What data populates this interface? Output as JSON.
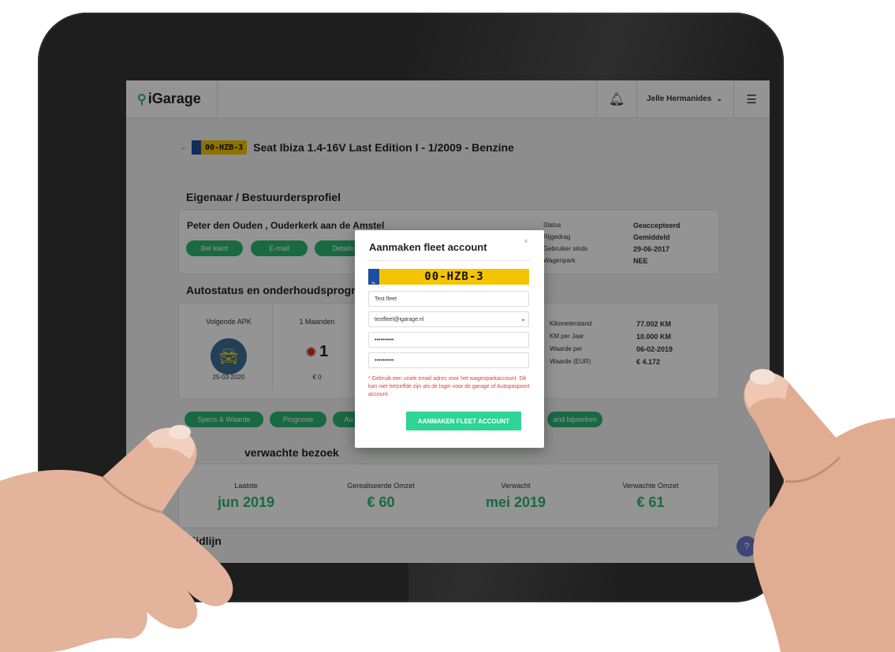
{
  "app": {
    "logo": "iGarage"
  },
  "topbar": {
    "user_name": "Jelle Hermanides"
  },
  "vehicle": {
    "plate": "00-HZB-3",
    "title": "Seat Ibiza 1.4-16V Last Edition I - 1/2009 - Benzine"
  },
  "owner_section": {
    "title": "Eigenaar / Bestuurdersprofiel",
    "name": "Peter den Ouden , Ouderkerk aan de Amstel",
    "buttons": [
      "Bel klant",
      "E-mail",
      "Details"
    ],
    "info": [
      {
        "label": "Status",
        "value": "Geaccepteerd"
      },
      {
        "label": "Rijgedrag",
        "value": "Gemiddeld"
      },
      {
        "label": "Gebruiker sinds",
        "value": "29-06-2017"
      },
      {
        "label": "Wagenpark",
        "value": "NEE"
      }
    ]
  },
  "status_section": {
    "title": "Autostatus en onderhoudsprogr",
    "apk_label": "Volgende APK",
    "apk_date": "25-03-2020",
    "months_label": "1 Maanden",
    "count": "1",
    "cost": "€ 0",
    "info": [
      {
        "label": "Kilometerstand",
        "value": "77.002 KM"
      },
      {
        "label": "KM per Jaar",
        "value": "10.000 KM"
      },
      {
        "label": "Waarde per",
        "value": "06-02-2019"
      },
      {
        "label": "Waarde (EUR)",
        "value": "€ 4.172"
      }
    ],
    "buttons": [
      "Specs & Waarde",
      "Prognose",
      "Au",
      "and bijwerken"
    ]
  },
  "visit_section": {
    "title": "verwachte bezoek",
    "kpis": [
      {
        "label": "Laatste",
        "value": "jun 2019"
      },
      {
        "label": "Gerealiseerde Omzet",
        "value": "€ 60"
      },
      {
        "label": "Verwacht",
        "value": "mei 2019"
      },
      {
        "label": "Verwachte Omzet",
        "value": "€ 61"
      }
    ]
  },
  "timeline": {
    "title": "Tijdlijn"
  },
  "modal": {
    "title": "Aanmaken fleet account",
    "close": "×",
    "plate": "00-HZB-3",
    "plate_country": "NL",
    "name_value": "Test fleet",
    "email_value": "testfleet@igarage.nl",
    "password_value": "••••••••••",
    "password_confirm_value": "••••••••••",
    "warning": "* Gebruik een uniek email adres voor het wagenparkaccount. Dit kan niet hetzelfde zijn als de login voor de garage of Autopaspoort account.",
    "submit_label": "AANMAKEN FLEET ACCOUNT"
  },
  "colors": {
    "accent": "#2bb673",
    "modal_button": "#2fd497",
    "plate": "#f5c400",
    "warning": "#e23b3b"
  }
}
